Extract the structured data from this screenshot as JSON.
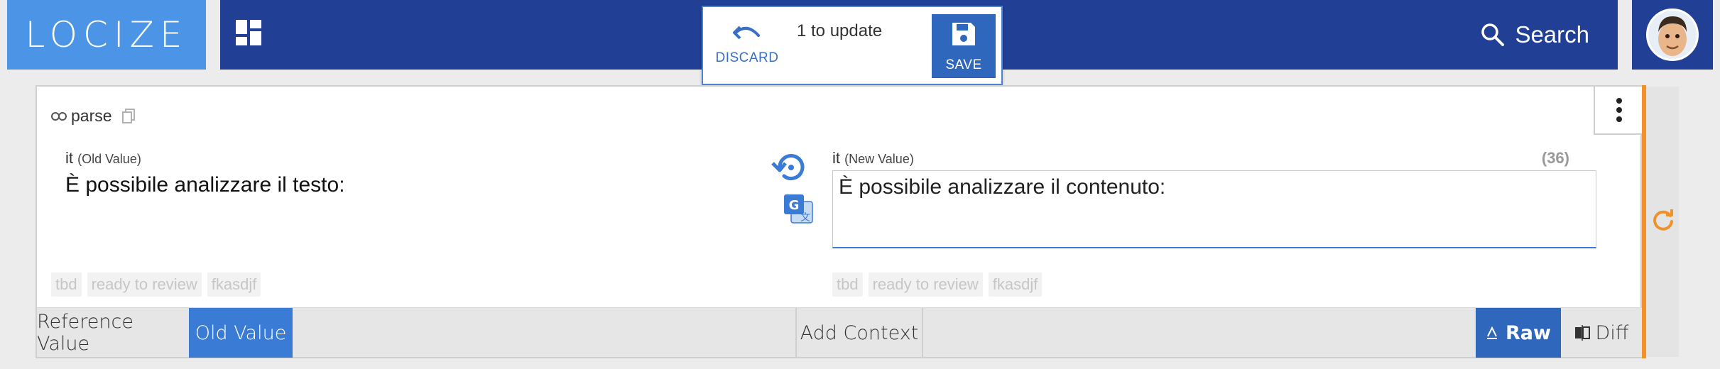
{
  "header": {
    "logo_text": "LOCIZE",
    "search_label": "Search"
  },
  "update_popup": {
    "discard_label": "DISCARD",
    "count_text": "1 to update",
    "save_label": "SAVE"
  },
  "card": {
    "key": "parse",
    "old": {
      "lang": "it",
      "lang_note": "(Old Value)",
      "text": "È possibile analizzare il testo:",
      "tags": [
        "tbd",
        "ready to review",
        "fkasdjf"
      ]
    },
    "new": {
      "lang": "it",
      "lang_note": "(New Value)",
      "text": "È possibile analizzare il contenuto:",
      "char_count": "(36)",
      "tags": [
        "tbd",
        "ready to review",
        "fkasdjf"
      ]
    },
    "tabs": {
      "reference_value": "Reference Value",
      "old_value": "Old Value",
      "add_context": "Add Context",
      "raw": "Raw",
      "diff": "Diff"
    }
  },
  "colors": {
    "topbar": "#203f95",
    "logo_bg": "#4b94e6",
    "accent": "#3a7bd5",
    "orange": "#f0912c"
  }
}
